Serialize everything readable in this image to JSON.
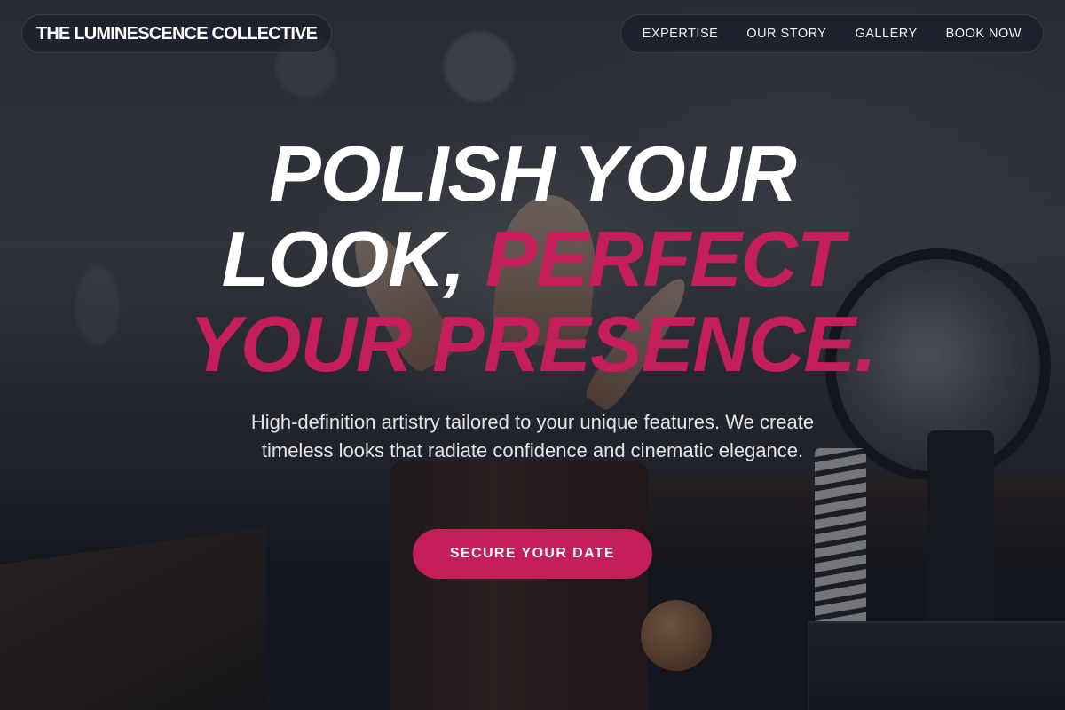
{
  "brand": {
    "name": "THE LUMINESCENCE COLLECTIVE"
  },
  "nav": {
    "items": [
      {
        "label": "EXPERTISE"
      },
      {
        "label": "OUR STORY"
      },
      {
        "label": "GALLERY"
      },
      {
        "label": "BOOK NOW"
      }
    ]
  },
  "hero": {
    "headline_line1": "POLISH YOUR",
    "headline_line2_plain": "LOOK, ",
    "headline_line2_accent": "PERFECT",
    "headline_line3_accent": "YOUR PRESENCE.",
    "subtext": "High-definition artistry tailored to your unique features. We create timeless looks that radiate confidence and cinematic elegance.",
    "cta_label": "SECURE YOUR DATE"
  },
  "colors": {
    "accent": "#c41f5b",
    "text": "#ffffff",
    "nav_background": "#1c2030"
  }
}
